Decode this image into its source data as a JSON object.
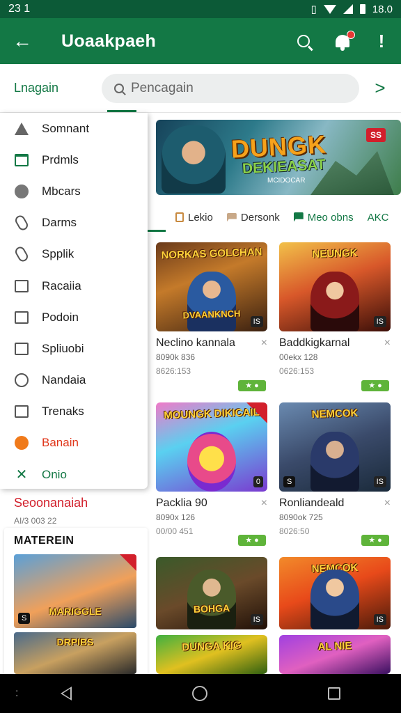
{
  "status_bar": {
    "time": "23 1",
    "right_text": "18.0"
  },
  "app_bar": {
    "title": "Uoaakpaeh"
  },
  "search": {
    "left_label": "Lnagain",
    "placeholder": "Pencagain"
  },
  "banner": {
    "logo_line1": "DUNGK",
    "logo_line2": "DEKIEASAT",
    "subtitle": "MCIDOCAR",
    "badge": "SS"
  },
  "tabs": [
    {
      "label": "Lekio"
    },
    {
      "label": "Dersonk"
    },
    {
      "label": "Meo obns"
    },
    {
      "label": "AKC"
    }
  ],
  "drawer": {
    "items": [
      {
        "label": "Somnant",
        "icon": "person-icon"
      },
      {
        "label": "Prdmls",
        "icon": "window-icon"
      },
      {
        "label": "Mbcars",
        "icon": "link-circle-icon"
      },
      {
        "label": "Darms",
        "icon": "phone-icon"
      },
      {
        "label": "Spplik",
        "icon": "chain-link-icon"
      },
      {
        "label": "Racaiia",
        "icon": "folder-icon"
      },
      {
        "label": "Podoin",
        "icon": "panel-icon"
      },
      {
        "label": "Spliuobi",
        "icon": "grid-icon"
      },
      {
        "label": "Nandaia",
        "icon": "magnifier-icon"
      },
      {
        "label": "Trenaks",
        "icon": "tablet-icon"
      },
      {
        "label": "Banain",
        "icon": "orange-dot-icon"
      },
      {
        "label": "Onio",
        "icon": "cross-arrows-icon"
      }
    ]
  },
  "left_section": {
    "title": "Seoonanaiah",
    "meta": "AI/3 003 22",
    "panel_title": "MATEREIN",
    "thumb1_title": "MARIGGLE",
    "thumb1_logo": "S",
    "thumb2_title": "DRPIBS"
  },
  "cards": [
    {
      "name": "Neclino kannala",
      "meta": "8090k 836",
      "meta2": "8626:153",
      "thumb_title": "NORKAS GOLCHAN",
      "caption": "DVAANKNCH",
      "age": "IS",
      "chip": "★ ●"
    },
    {
      "name": "Baddkigkarnal",
      "meta": "00ekx 128",
      "meta2": "0626:153",
      "thumb_title": "NEUNGK",
      "age": "IS",
      "chip": "★ ●"
    },
    {
      "name": "Packlia 90",
      "meta": "8090x 126",
      "meta2": "00/00 451",
      "thumb_title": "MOUNGK DIKICAIL",
      "age": "0",
      "chip": "★ ●"
    },
    {
      "name": "Ronliandeald",
      "meta": "8090ok 725",
      "meta2": "8026:50",
      "thumb_title": "NEMCOK",
      "logo": "S",
      "age": "IS",
      "chip": "★ ●"
    },
    {
      "name": "",
      "meta": "",
      "meta2": "",
      "thumb_title": "",
      "caption": "BOHGA",
      "age": "IS",
      "chip": ""
    },
    {
      "name": "",
      "meta": "",
      "meta2": "",
      "thumb_title": "NEMCOK",
      "age": "IS",
      "chip": ""
    },
    {
      "name": "",
      "meta": "",
      "meta2": "",
      "thumb_title": "DUNGA KIG",
      "age": "",
      "chip": ""
    },
    {
      "name": "",
      "meta": "",
      "meta2": "",
      "thumb_title": "AL NIE",
      "age": "",
      "chip": ""
    }
  ]
}
